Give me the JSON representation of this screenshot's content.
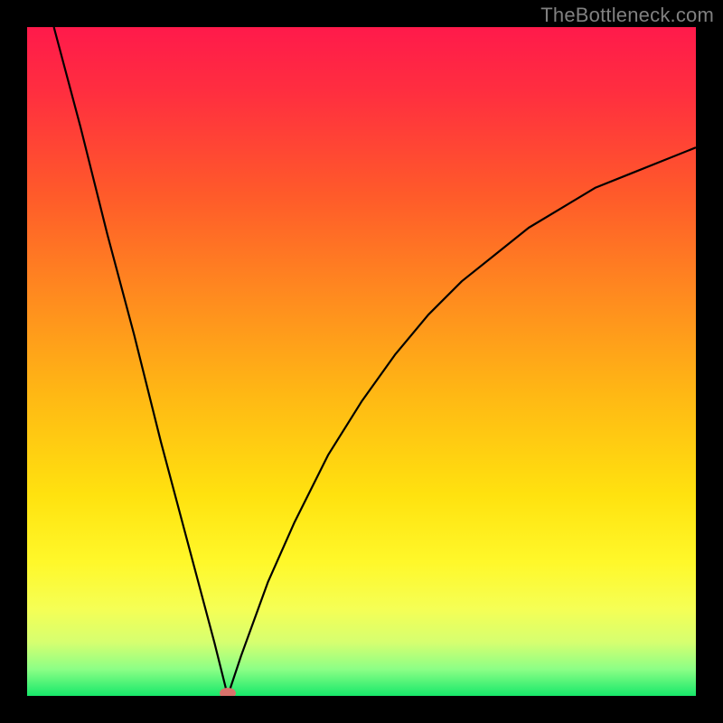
{
  "watermark": "TheBottleneck.com",
  "chart_data": {
    "type": "line",
    "title": "",
    "xlabel": "",
    "ylabel": "",
    "xlim": [
      0,
      100
    ],
    "ylim": [
      0,
      100
    ],
    "x_min_at": 30,
    "series": [
      {
        "name": "bottleneck-curve",
        "note": "V-shaped curve: steep linear descent from top-left to a minimum near x≈30 at y≈0, then a concave-rising curve toward upper right reaching y≈82 at x=100. Values estimated from pixel positions.",
        "x": [
          4,
          8,
          12,
          16,
          20,
          24,
          28,
          30,
          32,
          36,
          40,
          45,
          50,
          55,
          60,
          65,
          70,
          75,
          80,
          85,
          90,
          95,
          100
        ],
        "y": [
          100,
          85,
          69,
          54,
          38,
          23,
          8,
          0,
          6,
          17,
          26,
          36,
          44,
          51,
          57,
          62,
          66,
          70,
          73,
          76,
          78,
          80,
          82
        ]
      }
    ],
    "marker": {
      "x": 30,
      "y": 0,
      "color": "#d9726b"
    },
    "background_gradient": {
      "stops": [
        {
          "offset": 0.0,
          "color": "#ff1a4b"
        },
        {
          "offset": 0.1,
          "color": "#ff2f3f"
        },
        {
          "offset": 0.25,
          "color": "#ff5a2a"
        },
        {
          "offset": 0.4,
          "color": "#ff8a1f"
        },
        {
          "offset": 0.55,
          "color": "#ffb814"
        },
        {
          "offset": 0.7,
          "color": "#ffe20f"
        },
        {
          "offset": 0.8,
          "color": "#fff82a"
        },
        {
          "offset": 0.87,
          "color": "#f5ff55"
        },
        {
          "offset": 0.92,
          "color": "#d6ff70"
        },
        {
          "offset": 0.96,
          "color": "#8cff86"
        },
        {
          "offset": 1.0,
          "color": "#17e86a"
        }
      ]
    }
  }
}
